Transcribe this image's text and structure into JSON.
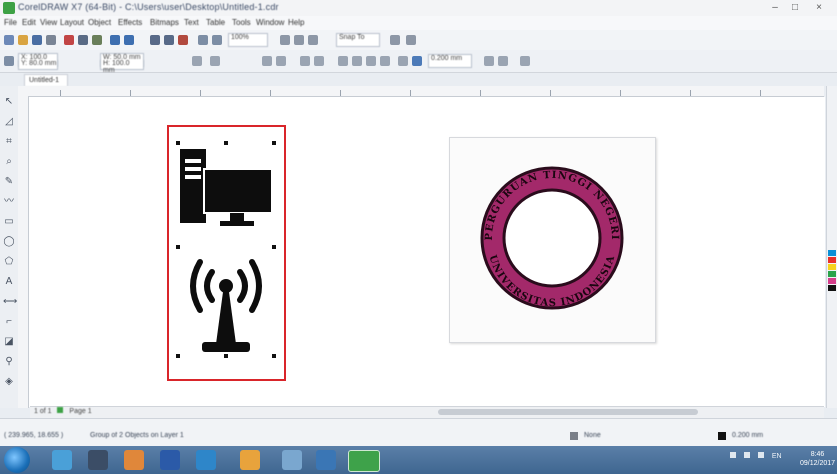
{
  "window": {
    "title": "CorelDRAW X7 (64-Bit) - C:\\Users\\user\\Desktop\\Untitled-1.cdr",
    "minimize": "–",
    "maximize": "□",
    "close": "×"
  },
  "menu": [
    "File",
    "Edit",
    "View",
    "Layout",
    "Object",
    "Effects",
    "Bitmaps",
    "Text",
    "Table",
    "Tools",
    "Window",
    "Help"
  ],
  "toolbar": {
    "zoom": "100%",
    "snap_to": "Snap To",
    "x_field": "X: 100.0 mm",
    "y_field": "Y: 80.0 mm",
    "w_field": "W: 50.0 mm",
    "h_field": "H: 100.0 mm",
    "units": "mm"
  },
  "document_tab": "Untitled-1",
  "page_nav": {
    "position": "1 of 1",
    "page_label": "Page 1"
  },
  "status": {
    "coordinates": "( 239.965, 18.655 )",
    "message": "Group of 2 Objects on Layer 1",
    "fill": "None",
    "outline": "0.200 mm"
  },
  "badge": {
    "top_text": "PERGURUAN TINGGI NEGERI",
    "bottom_text": "UNIVERSITAS INDONESIA",
    "ring_color": "#a3296a"
  },
  "tray": {
    "status": "EN",
    "time": "8:46",
    "date": "09/12/2017"
  },
  "colors": {
    "accent": "#d9252a",
    "ring": "#a3296a"
  },
  "icons": {
    "computer": "computer-monitor-icon",
    "antenna": "wireless-antenna-icon"
  }
}
